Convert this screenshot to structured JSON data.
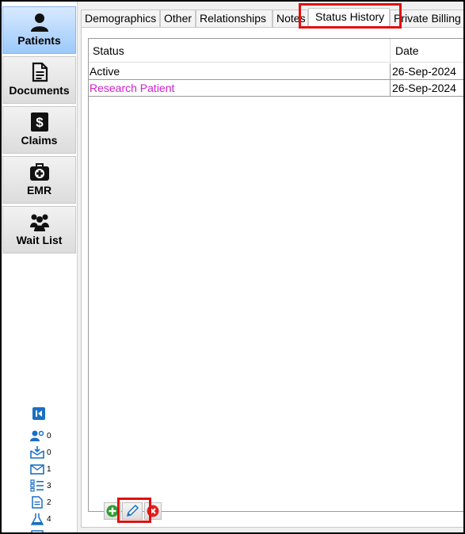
{
  "sidebar": {
    "items": [
      {
        "label": "Patients",
        "icon": "person-icon",
        "active": true
      },
      {
        "label": "Documents",
        "icon": "document-icon",
        "active": false
      },
      {
        "label": "Claims",
        "icon": "dollar-icon",
        "active": false
      },
      {
        "label": "EMR",
        "icon": "medical-bag-icon",
        "active": false
      },
      {
        "label": "Wait List",
        "icon": "group-icon",
        "active": false
      }
    ],
    "stats": [
      {
        "icon": "patient-key-icon",
        "count": "0"
      },
      {
        "icon": "inbox-download-icon",
        "count": "0"
      },
      {
        "icon": "envelope-icon",
        "count": "1"
      },
      {
        "icon": "checklist-icon",
        "count": "3"
      },
      {
        "icon": "document-icon",
        "count": "2"
      },
      {
        "icon": "lab-flask-icon",
        "count": "4"
      }
    ]
  },
  "tabs": [
    "Demographics",
    "Other",
    "Relationships",
    "Notes",
    "Status History",
    "Private Billing"
  ],
  "active_tab": "Status History",
  "status_table": {
    "columns": [
      "Status",
      "Date"
    ],
    "rows": [
      {
        "status": "Active",
        "date": "26-Sep-2024",
        "color": "#000000"
      },
      {
        "status": "Research Patient",
        "date": "26-Sep-2024",
        "color": "#d020d0"
      }
    ]
  },
  "colors": {
    "active_nav": "#9cc9fb",
    "highlight": "#e01010",
    "add": "#2e9e2e",
    "edit": "#1a6fc4",
    "delete": "#e02020"
  }
}
